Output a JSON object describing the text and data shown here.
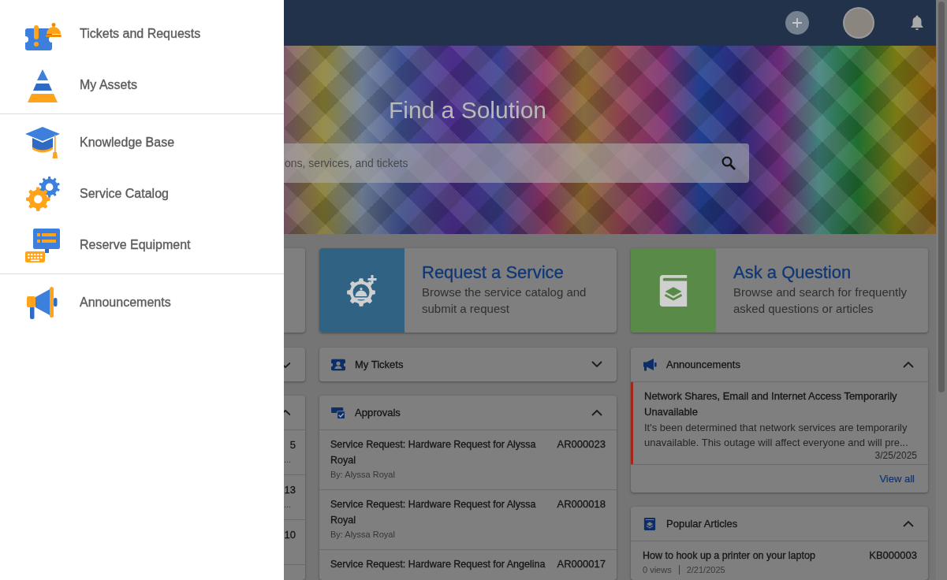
{
  "drawer": {
    "sections": [
      {
        "items": [
          {
            "label": "Tickets and Requests",
            "selected": false
          },
          {
            "label": "My Assets",
            "selected": false
          }
        ]
      },
      {
        "items": [
          {
            "label": "Knowledge Base",
            "selected": false
          },
          {
            "label": "Service Catalog",
            "selected": false
          },
          {
            "label": "Reserve Equipment",
            "selected": false
          }
        ]
      },
      {
        "items": [
          {
            "label": "Announcements",
            "selected": false
          }
        ]
      }
    ]
  },
  "hero": {
    "title": "Find a Solution",
    "search": {
      "placeholder": "ons, services, and tickets"
    }
  },
  "quick_actions": [
    {
      "title": "Request a Service",
      "description": "Browse the service catalog and submit a request",
      "color": "#306383"
    },
    {
      "title": "Ask a Question",
      "description": "Browse and search for frequently asked questions or articles",
      "color": "#5a8a48"
    }
  ],
  "left_column": {
    "panels": [
      {
        "expanded": false
      },
      {
        "expanded": true,
        "rows": [
          {
            "number": "5",
            "description": "..."
          },
          {
            "number": "13",
            "description": "..."
          },
          {
            "number": "10"
          }
        ]
      }
    ]
  },
  "middle_column": {
    "panels": [
      {
        "kind": "tickets",
        "title": "My Tickets",
        "expanded": false
      },
      {
        "kind": "approvals",
        "title": "Approvals",
        "expanded": true,
        "rows": [
          {
            "title": "Service Request: Hardware Request for Alyssa Royal",
            "number": "AR000023",
            "requester": "By: Alyssa Royal"
          },
          {
            "title": "Service Request: Hardware Request for Alyssa Royal",
            "number": "AR000018",
            "requester": "By: Alyssa Royal"
          },
          {
            "title": "Service Request: Hardware Request for Angelina",
            "number": "AR000017"
          }
        ]
      }
    ]
  },
  "right_column": {
    "panels": [
      {
        "kind": "announcements",
        "title": "Announcements",
        "expanded": true,
        "items": [
          {
            "title": "Network Shares, Email and Internet Access Temporarily Unavailable",
            "body": "It's been determined that network services are temporarily unavailable. This outage will affect everyone and will pre...",
            "date": "3/25/2025",
            "color": "#a3281b"
          }
        ],
        "link": "View all"
      },
      {
        "kind": "articles",
        "title": "Popular Articles",
        "expanded": true,
        "rows": [
          {
            "title": "How to hook up a printer on your laptop",
            "number": "KB000003",
            "views": "0 views",
            "date": "2/21/2025"
          }
        ]
      }
    ]
  }
}
